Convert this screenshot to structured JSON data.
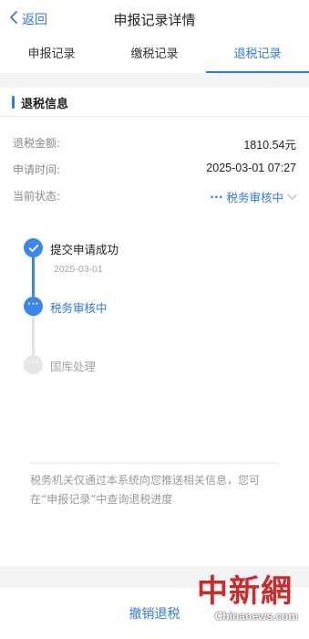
{
  "header": {
    "back_label": "返回",
    "title": "申报记录详情"
  },
  "tabs": [
    {
      "label": "申报记录",
      "active": false
    },
    {
      "label": "缴税记录",
      "active": false
    },
    {
      "label": "退税记录",
      "active": true
    }
  ],
  "section": {
    "title": "退税信息"
  },
  "info": {
    "amount_label": "退税金额:",
    "amount_value": "1810.54元",
    "time_label": "申请时间:",
    "time_value": "2025-03-01 07:27",
    "status_label": "当前状态:",
    "status_dots": "···",
    "status_value": "税务审核中"
  },
  "timeline": [
    {
      "title": "提交申请成功",
      "date": "2025-03-01",
      "state": "done"
    },
    {
      "title": "税务审核中",
      "state": "current"
    },
    {
      "title": "国库处理",
      "state": "pending"
    }
  ],
  "notice": "税务机关仅通过本系统向您推送相关信息，您可在“申报记录”中查询退税进度",
  "bottom": {
    "cancel_label": "撤销退税"
  },
  "watermark": {
    "cn": "中新網",
    "en": "Chinanews.com"
  },
  "colors": {
    "accent": "#2f7ae5",
    "timeline_active": "#3a86ee",
    "timeline_pending": "#e6e6e6"
  }
}
